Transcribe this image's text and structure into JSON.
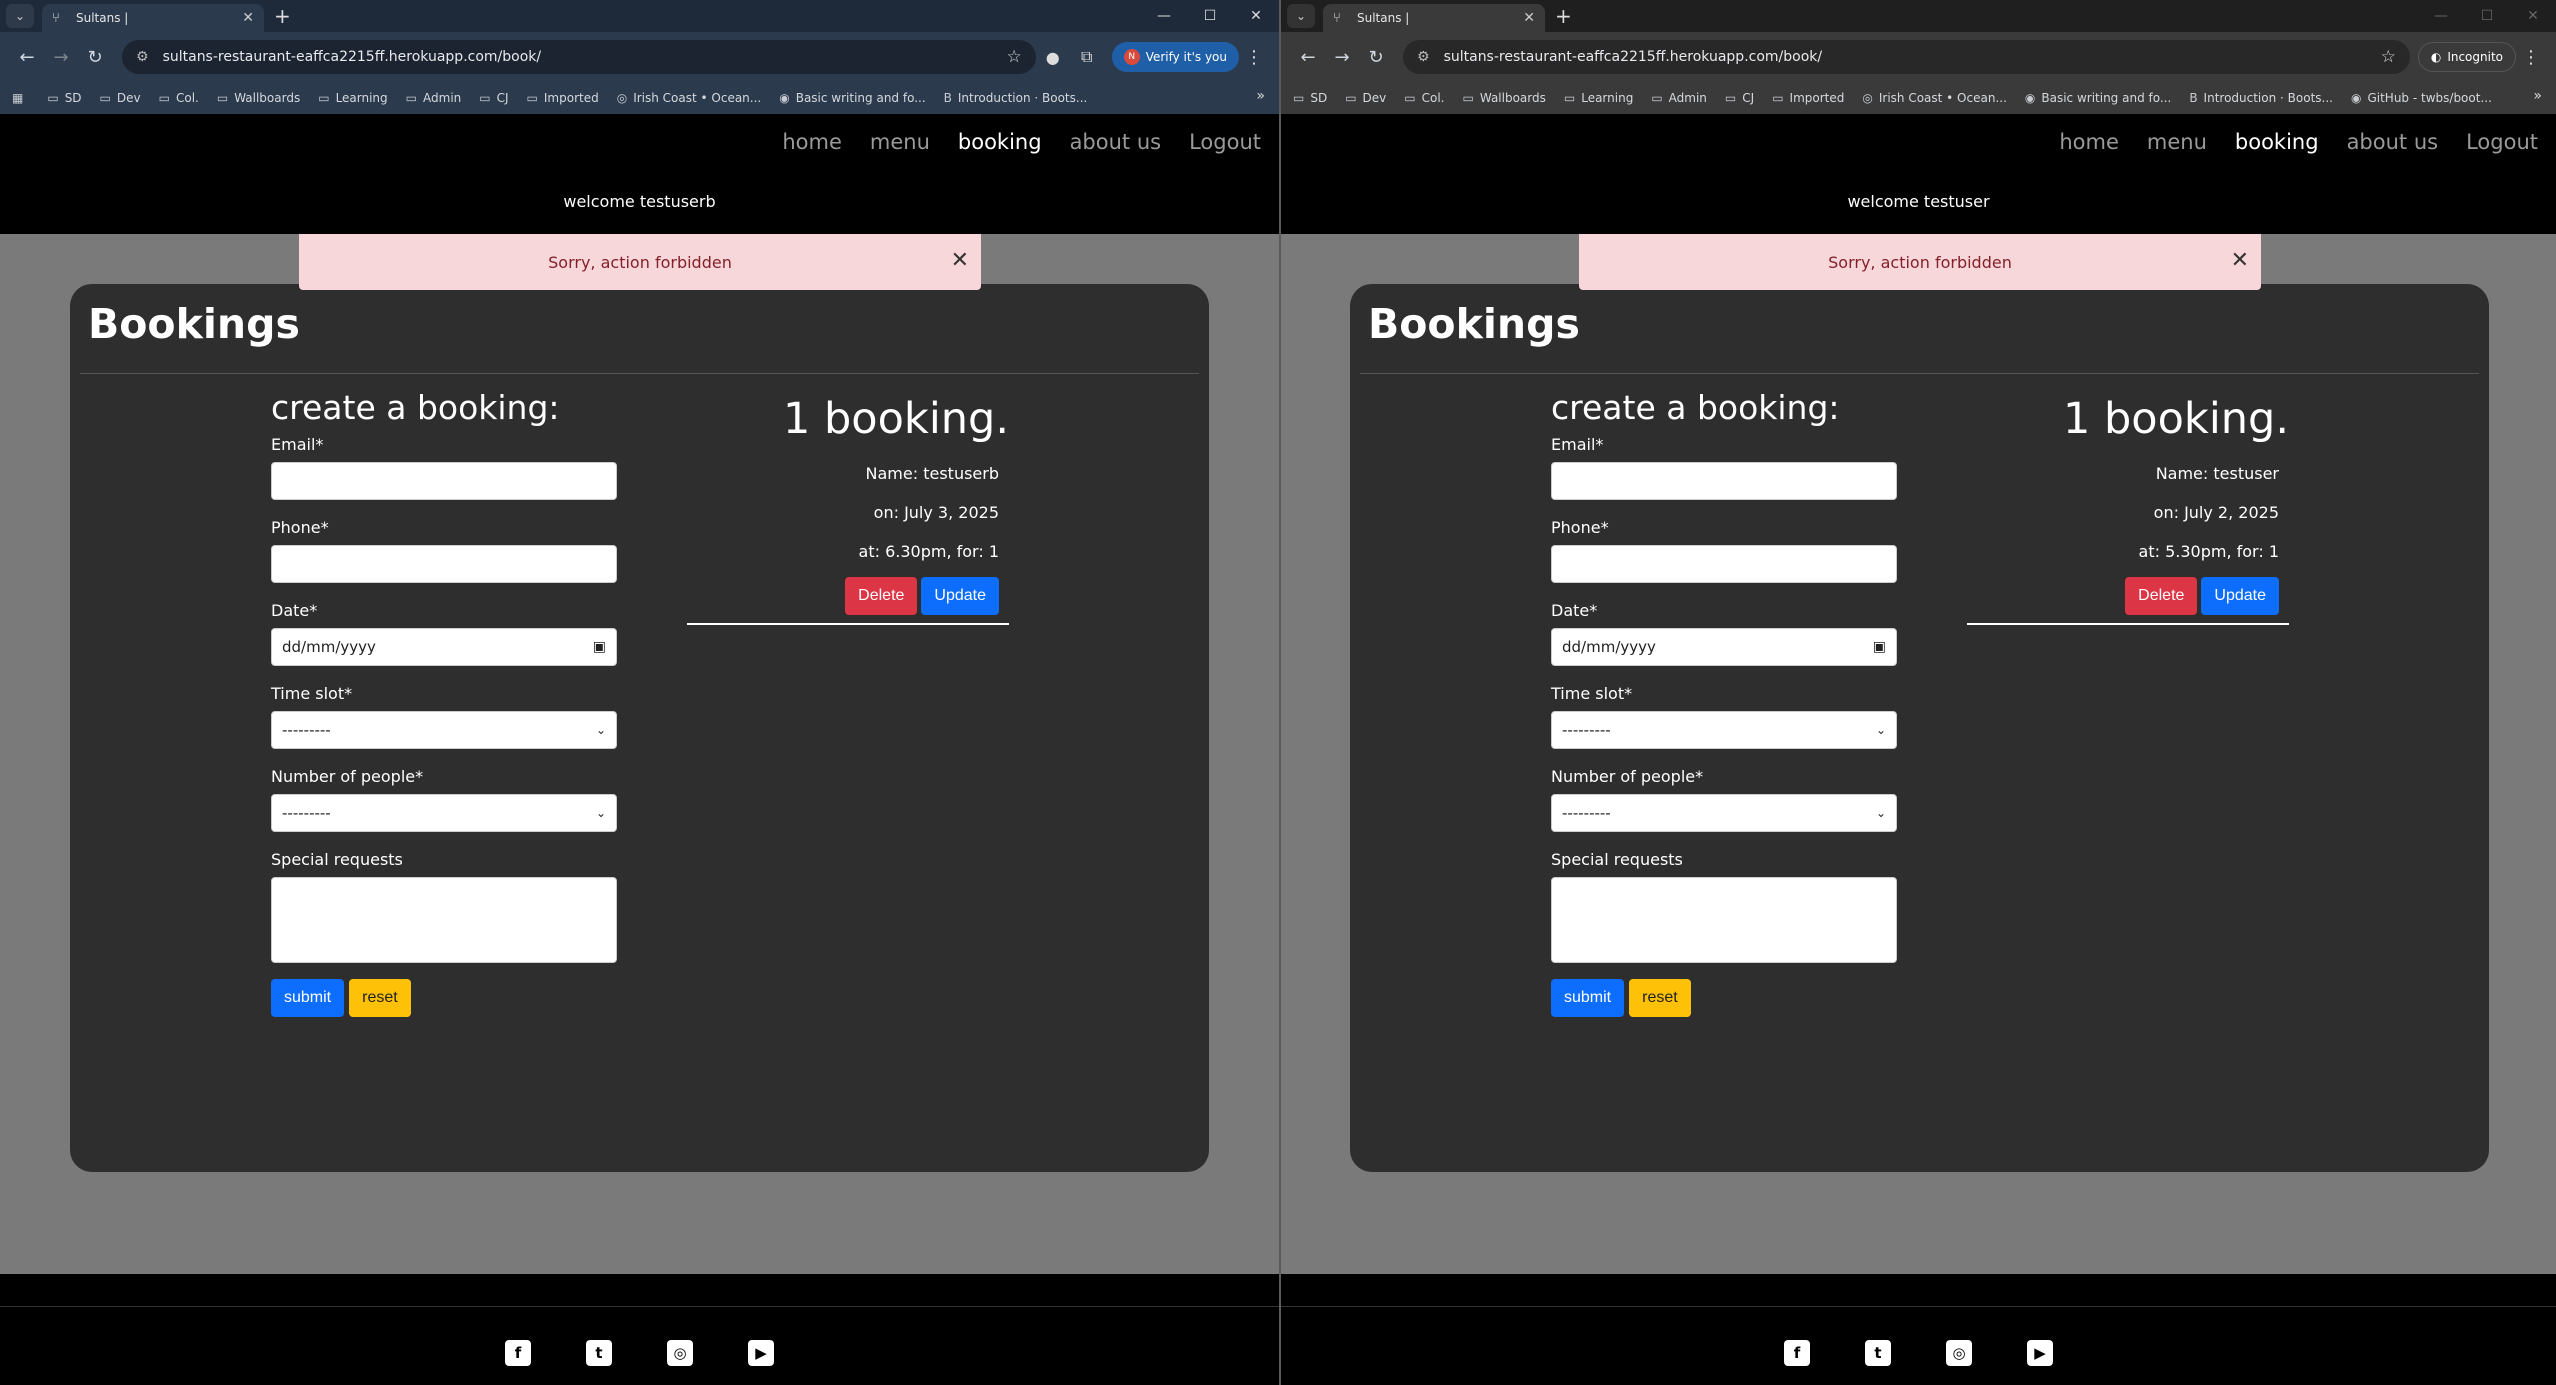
{
  "windows": [
    {
      "tab_title": "Sultans |",
      "url": "sultans-restaurant-eaffca2215ff.herokuapp.com/book/",
      "profile_label": "Verify it's you",
      "profile_letter": "N",
      "bookmarks": [
        "SD",
        "Dev",
        "Col.",
        "Wallboards",
        "Learning",
        "Admin",
        "CJ",
        "Imported",
        "Irish Coast • Ocean...",
        "Basic writing and fo...",
        "Introduction · Boots..."
      ],
      "nav": [
        "home",
        "menu",
        "booking",
        "about us",
        "Logout"
      ],
      "welcome": "welcome testuserb",
      "alert": "Sorry, action forbidden",
      "card_title": "Bookings",
      "form": {
        "heading": "create a booking:",
        "email_label": "Email*",
        "phone_label": "Phone*",
        "date_label": "Date*",
        "date_placeholder": "dd/mm/yyyy",
        "timeslot_label": "Time slot*",
        "timeslot_value": "---------",
        "people_label": "Number of people*",
        "people_value": "---------",
        "requests_label": "Special requests",
        "submit": "submit",
        "reset": "reset"
      },
      "booking": {
        "count": "1 booking.",
        "name": "Name: testuserb",
        "date": "on: July 3, 2025",
        "time": "at: 6.30pm, for: 1",
        "delete": "Delete",
        "update": "Update"
      }
    },
    {
      "tab_title": "Sultans |",
      "url": "sultans-restaurant-eaffca2215ff.herokuapp.com/book/",
      "profile_label": "Incognito",
      "bookmarks": [
        "SD",
        "Dev",
        "Col.",
        "Wallboards",
        "Learning",
        "Admin",
        "CJ",
        "Imported",
        "Irish Coast • Ocean...",
        "Basic writing and fo...",
        "Introduction · Boots...",
        "GitHub - twbs/boot..."
      ],
      "nav": [
        "home",
        "menu",
        "booking",
        "about us",
        "Logout"
      ],
      "welcome": "welcome testuser",
      "alert": "Sorry, action forbidden",
      "card_title": "Bookings",
      "form": {
        "heading": "create a booking:",
        "email_label": "Email*",
        "phone_label": "Phone*",
        "date_label": "Date*",
        "date_placeholder": "dd/mm/yyyy",
        "timeslot_label": "Time slot*",
        "timeslot_value": "---------",
        "people_label": "Number of people*",
        "people_value": "---------",
        "requests_label": "Special requests",
        "submit": "submit",
        "reset": "reset"
      },
      "booking": {
        "count": "1 booking.",
        "name": "Name: testuser",
        "date": "on: July 2, 2025",
        "time": "at: 5.30pm, for: 1",
        "delete": "Delete",
        "update": "Update"
      }
    }
  ],
  "icons": {
    "social": [
      "facebook-icon",
      "twitter-icon",
      "instagram-icon",
      "youtube-icon"
    ]
  }
}
